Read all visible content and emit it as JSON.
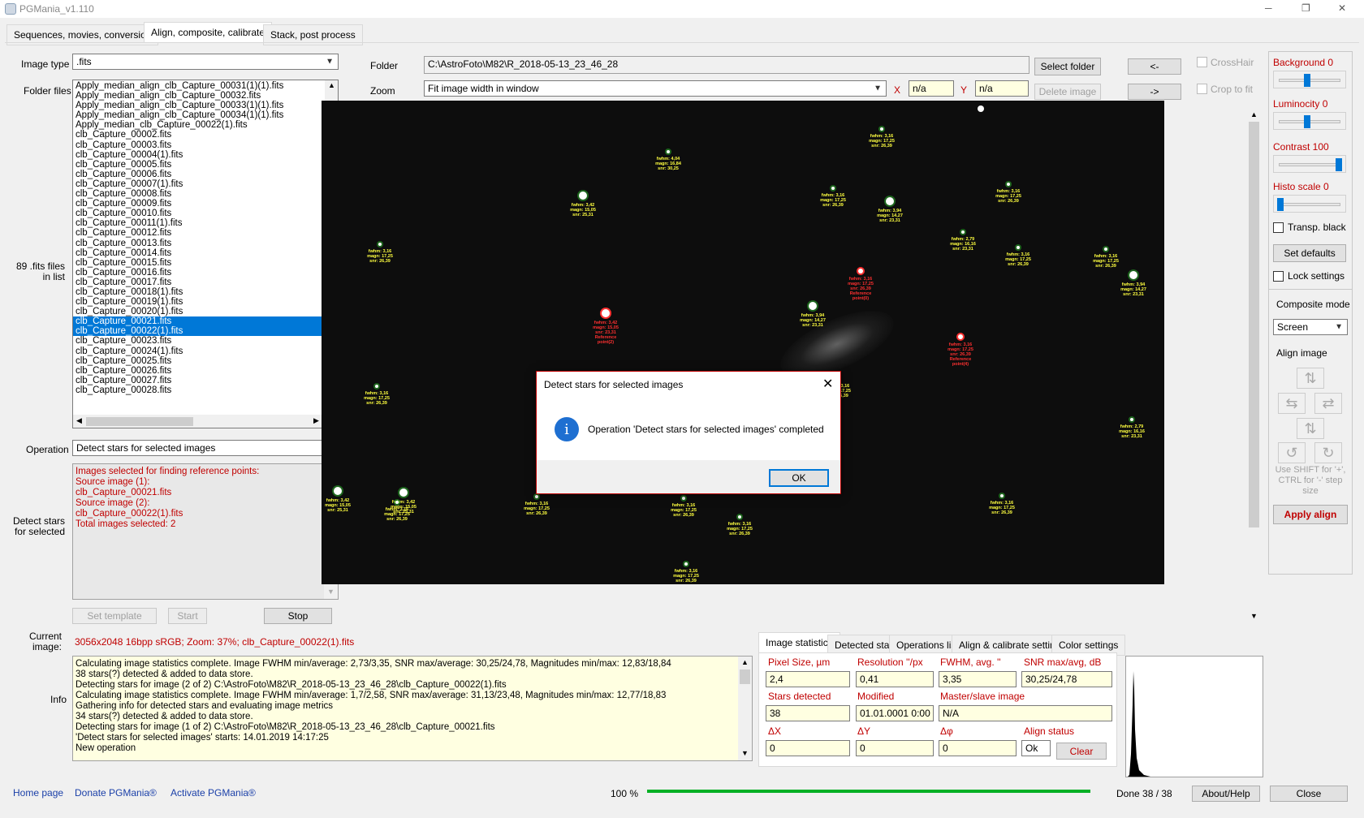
{
  "window": {
    "title": "PGMania_v1.110",
    "minimize": "─",
    "maximize": "❐",
    "close": "✕"
  },
  "main_tabs": [
    {
      "label": "Sequences, movies, conversion"
    },
    {
      "label": "Align, composite, calibrate"
    },
    {
      "label": "Stack, post process"
    }
  ],
  "left": {
    "image_type_label": "Image type",
    "image_type_value": ".fits",
    "folder_files_label": "Folder files",
    "files_count_label": "89 .fits files in list",
    "files": [
      "Apply_median_align_clb_Capture_00031(1)(1).fits",
      "Apply_median_align_clb_Capture_00032.fits",
      "Apply_median_align_clb_Capture_00033(1)(1).fits",
      "Apply_median_align_clb_Capture_00034(1)(1).fits",
      "Apply_median_clb_Capture_00022(1).fits",
      "clb_Capture_00002.fits",
      "clb_Capture_00003.fits",
      "clb_Capture_00004(1).fits",
      "clb_Capture_00005.fits",
      "clb_Capture_00006.fits",
      "clb_Capture_00007(1).fits",
      "clb_Capture_00008.fits",
      "clb_Capture_00009.fits",
      "clb_Capture_00010.fits",
      "clb_Capture_00011(1).fits",
      "clb_Capture_00012.fits",
      "clb_Capture_00013.fits",
      "clb_Capture_00014.fits",
      "clb_Capture_00015.fits",
      "clb_Capture_00016.fits",
      "clb_Capture_00017.fits",
      "clb_Capture_00018(1).fits",
      "clb_Capture_00019(1).fits",
      "clb_Capture_00020(1).fits",
      "clb_Capture_00021.fits",
      "clb_Capture_00022(1).fits",
      "clb_Capture_00023.fits",
      "clb_Capture_00024(1).fits",
      "clb_Capture_00025.fits",
      "clb_Capture_00026.fits",
      "clb_Capture_00027.fits",
      "clb_Capture_00028.fits"
    ],
    "selected_files": [
      "clb_Capture_00021.fits",
      "clb_Capture_00022(1).fits"
    ],
    "operation_label": "Operation",
    "operation_value": "Detect stars for selected images",
    "detect_label": "Detect stars for selected",
    "log_lines": [
      "Images selected for finding reference points:",
      "Source image (1):",
      "clb_Capture_00021.fits",
      "Source image (2):",
      "clb_Capture_00022(1).fits",
      "Total images selected: 2"
    ],
    "set_template": "Set template",
    "start": "Start",
    "stop": "Stop",
    "current_image_label": "Current image:",
    "current_image_value": "3056x2048 16bpp sRGB; Zoom: 37%; clb_Capture_00022(1).fits",
    "info_label": "Info",
    "info_lines": [
      "Calculating image statistics complete. Image FWHM min/average: 2,73/3,35, SNR max/average: 30,25/24,78, Magnitudes min/max: 12,83/18,84",
      "38 stars(?) detected & added to data store.",
      "Detecting stars for image (2 of 2) C:\\AstroFoto\\M82\\R_2018-05-13_23_46_28\\clb_Capture_00022(1).fits",
      "Calculating image statistics complete. Image FWHM min/average: 1,7/2,58, SNR max/average: 31,13/23,48, Magnitudes min/max: 12,77/18,83",
      "Gathering info for detected stars and evaluating image metrics",
      "34 stars(?) detected & added to data store.",
      "Detecting stars for image (1 of 2) C:\\AstroFoto\\M82\\R_2018-05-13_23_46_28\\clb_Capture_00021.fits",
      "'Detect stars for selected images' starts: 14.01.2019 14:17:25",
      "New operation"
    ]
  },
  "top": {
    "folder_label": "Folder",
    "folder_value": "C:\\AstroFoto\\M82\\R_2018-05-13_23_46_28",
    "select_folder": "Select folder",
    "zoom_label": "Zoom",
    "zoom_value": "Fit image width in window",
    "x_label": "X",
    "x_value": "n/a",
    "y_label": "Y",
    "y_value": "n/a",
    "delete_image": "Delete image",
    "prev": "<-",
    "next": "->",
    "crosshair": "CrossHair",
    "crop_to_fit": "Crop to fit"
  },
  "right": {
    "background": "Background 0",
    "luminocity": "Luminocity 0",
    "contrast": "Contrast 100",
    "histo_scale": "Histo scale 0",
    "transp_black": "Transp. black",
    "set_defaults": "Set defaults",
    "lock_settings": "Lock settings",
    "composite_mode_label": "Composite mode",
    "composite_mode_value": "Screen",
    "align_image_label": "Align image",
    "shift_hint": "Use SHIFT for '+', CTRL for '-' step size",
    "apply_align": "Apply align",
    "slider_levels": {
      "background": 0.45,
      "luminocity": 0.45,
      "contrast": 0.97,
      "histo_scale": 0.0
    }
  },
  "dialog": {
    "title": "Detect stars for selected images",
    "message": "Operation 'Detect stars for selected images' completed",
    "ok": "OK",
    "info_icon": "i"
  },
  "stats_tabs": [
    {
      "label": "Image statistics"
    },
    {
      "label": "Detected stars"
    },
    {
      "label": "Operations list"
    },
    {
      "label": "Align & calibrate settings"
    },
    {
      "label": "Color settings"
    }
  ],
  "stats": {
    "pixel_size_label": "Pixel Size, µm",
    "pixel_size": "2,4",
    "resolution_label": "Resolution ''/px",
    "resolution": "0,41",
    "fwhm_label": "FWHM, avg. ''",
    "fwhm": "3,35",
    "snr_label": "SNR max/avg, dB",
    "snr": "30,25/24,78",
    "stars_detected_label": "Stars detected",
    "stars_detected": "38",
    "modified_label": "Modified",
    "modified": "01.01.0001 0:00",
    "master_slave_label": "Master/slave image",
    "master_slave": "N/A",
    "dx_label": "ΔX",
    "dx": "0",
    "dy_label": "ΔY",
    "dy": "0",
    "dphi_label": "Δφ",
    "dphi": "0",
    "align_status_label": "Align status",
    "align_status": "Ok",
    "clear": "Clear"
  },
  "footer": {
    "home_page": "Home page",
    "donate": "Donate PGMania®",
    "activate": "Activate PGMania®",
    "progress_text": "100 %",
    "progress_fraction": 1.0,
    "done": "Done 38 / 38",
    "about": "About/Help",
    "close": "Close"
  },
  "stars": [
    {
      "l1": "fwhm: 3,42",
      "l2": "magn: 15,05",
      "l3": "snr: 25,31"
    },
    {
      "l1": "fwhm: 3,16",
      "l2": "magn: 17,25",
      "l3": "snr: 26,39"
    },
    {
      "l1": "fwhm: 3,94",
      "l2": "magn: 14,27",
      "l3": "snr: 23,31"
    },
    {
      "l1": "fwhm: 4,04",
      "l2": "magn: 16,84",
      "l3": "snr: 30,25"
    },
    {
      "l1": "fwhm: 2,79",
      "l2": "magn: 16,16",
      "l3": "snr: 23,31"
    },
    {
      "l1": "fwhm: 3,16",
      "l2": "magn: 17,25",
      "l3": "snr: 26,39",
      "ref": "Reference point(0)"
    },
    {
      "l1": "fwhm: 3,42",
      "l2": "magn: 15,05",
      "l3": "snr: 23,31",
      "ref": "Reference point(2)"
    },
    {
      "l1": "fwhm: 3,16",
      "l2": "magn: 17,25",
      "l3": "snr: 26,39",
      "ref": "Reference point(4)"
    }
  ],
  "colors": {
    "accent": "#0078d7",
    "label_red": "#c00000",
    "star_yellow": "#ffff40",
    "star_red": "#ff3030",
    "progress_green": "#06b025"
  }
}
